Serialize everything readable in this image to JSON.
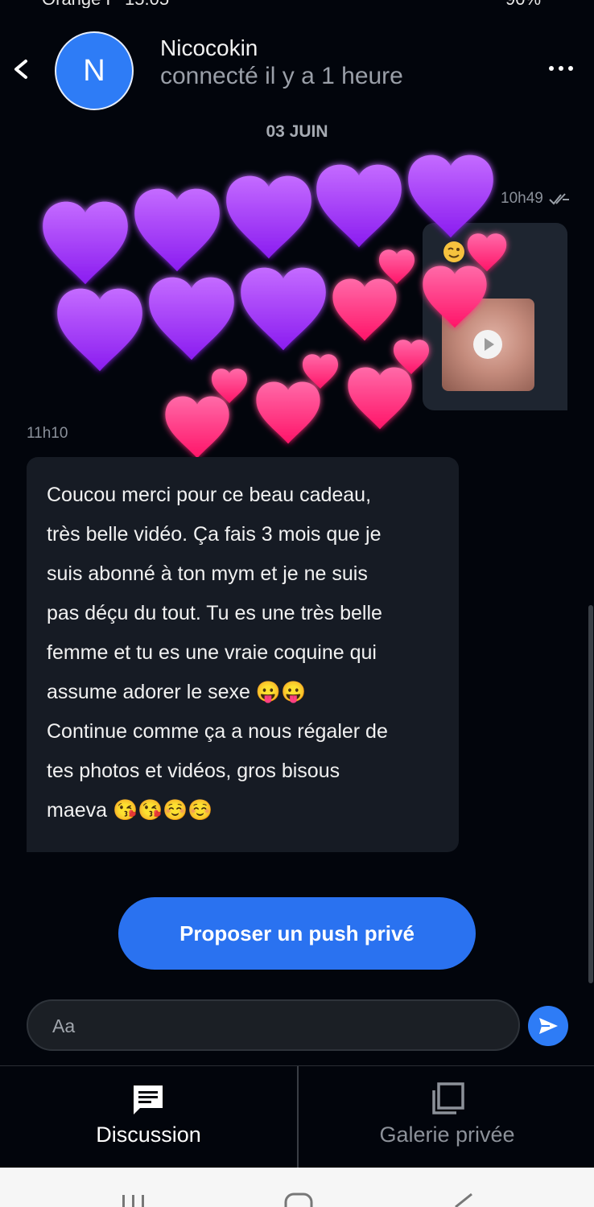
{
  "status_bar": {
    "carrier": "Orange F",
    "clock": "15:05",
    "battery": "90%"
  },
  "header": {
    "avatar_letter": "N",
    "name": "Nicocokin",
    "presence": "connecté il y a 1 heure"
  },
  "date_separator": "03 JUIN",
  "outgoing": {
    "time": "10h49"
  },
  "incoming": {
    "time": "11h10",
    "lines": [
      "Coucou merci pour ce beau cadeau,",
      "très belle vidéo. Ça fais 3 mois que je",
      "suis abonné à ton mym et je ne suis",
      "pas déçu du tout. Tu es une très belle",
      "femme et tu es une vraie coquine qui",
      "assume adorer le sexe 😛😛",
      "Continue comme ça a nous régaler de",
      "tes photos et vidéos, gros bisous",
      "maeva 😘😘☺️☺️"
    ]
  },
  "push_button": "Proposer un push privé",
  "composer": {
    "placeholder": "Aa"
  },
  "tabs": {
    "discussion": "Discussion",
    "gallery": "Galerie privée"
  },
  "colors": {
    "accent": "#2e7cf6",
    "purple_heart": "#9b2cf5",
    "pink_heart": "#ff2a7d"
  }
}
